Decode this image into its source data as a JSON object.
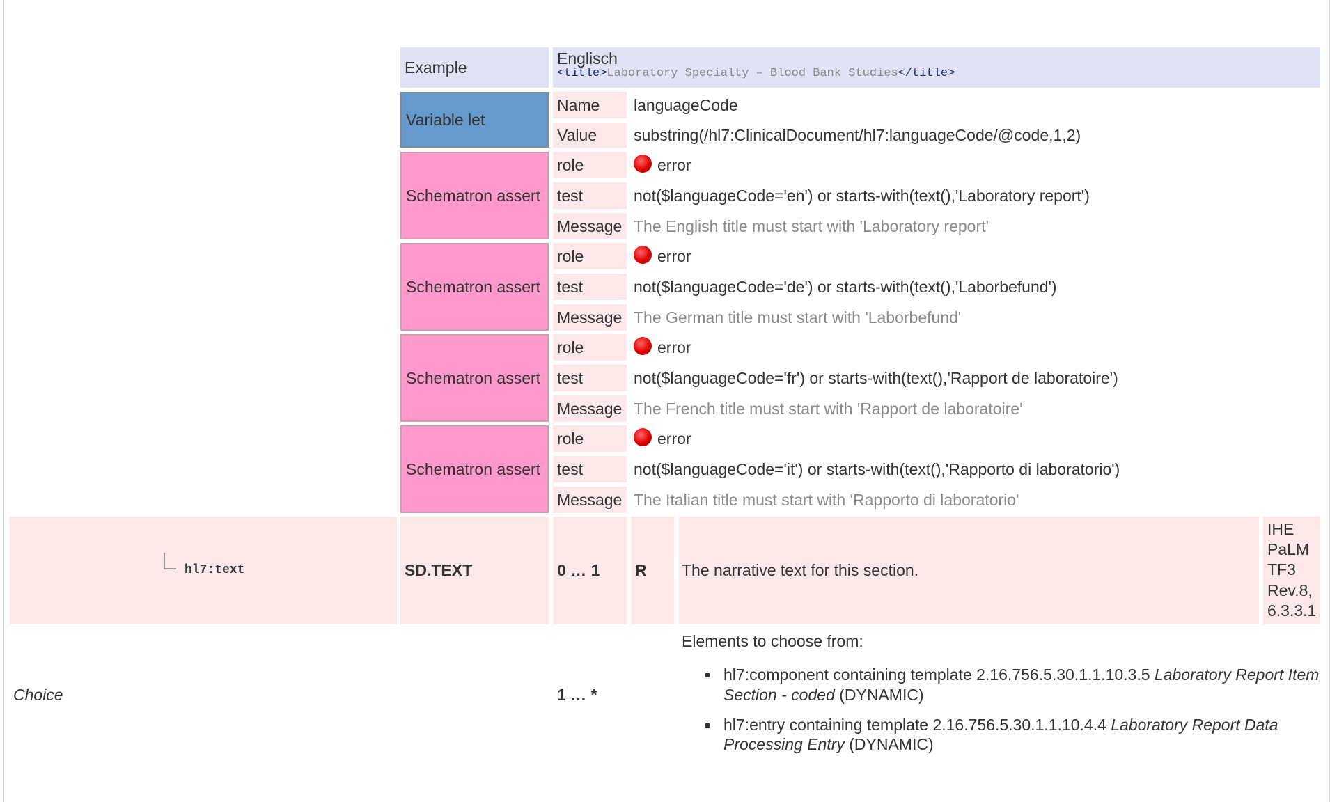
{
  "example": {
    "label": "Example",
    "language": "Englisch",
    "code_open": "<title>",
    "code_text": "Laboratory Specialty – Blood Bank Studies",
    "code_close": "</title>"
  },
  "variable_let": {
    "label": "Variable let",
    "rows": [
      {
        "key": "Name",
        "value": "languageCode"
      },
      {
        "key": "Value",
        "value": "substring(/hl7:ClinicalDocument/hl7:languageCode/@code,1,2)"
      }
    ]
  },
  "schematron_asserts": [
    {
      "label": "Schematron assert",
      "role_key": "role",
      "role": "error",
      "test_key": "test",
      "test": "not($languageCode='en') or starts-with(text(),'Laboratory report')",
      "message_key": "Message",
      "message": "The English title must start with 'Laboratory report'"
    },
    {
      "label": "Schematron assert",
      "role_key": "role",
      "role": "error",
      "test_key": "test",
      "test": "not($languageCode='de') or starts-with(text(),'Laborbefund')",
      "message_key": "Message",
      "message": "The German title must start with 'Laborbefund'"
    },
    {
      "label": "Schematron assert",
      "role_key": "role",
      "role": "error",
      "test_key": "test",
      "test": "not($languageCode='fr') or starts-with(text(),'Rapport de laboratoire')",
      "message_key": "Message",
      "message": "The French title must start with 'Rapport de laboratoire'"
    },
    {
      "label": "Schematron assert",
      "role_key": "role",
      "role": "error",
      "test_key": "test",
      "test": "not($languageCode='it') or starts-with(text(),'Rapporto di laboratorio')",
      "message_key": "Message",
      "message": "The Italian title must start with 'Rapporto di laboratorio'"
    }
  ],
  "text_row": {
    "element": "hl7:text",
    "datatype": "SD.TEXT",
    "cardinality": "0 … 1",
    "conformance": "R",
    "description": "The narrative text for this section.",
    "source_lines": [
      "IHE",
      "PaLM",
      "TF3",
      "Rev.8,",
      "6.3.3.1"
    ]
  },
  "choice_row": {
    "label": "Choice",
    "cardinality": "1 … *",
    "intro": "Elements to choose from:",
    "items": [
      {
        "prefix": "hl7:component containing template 2.16.756.5.30.1.1.10.3.5 ",
        "name": "Laboratory Report Item Section - coded",
        "suffix": " (DYNAMIC)"
      },
      {
        "prefix": "hl7:entry containing template 2.16.756.5.30.1.1.10.4.4 ",
        "name": "Laboratory Report Data Processing Entry",
        "suffix": " (DYNAMIC)"
      }
    ]
  }
}
